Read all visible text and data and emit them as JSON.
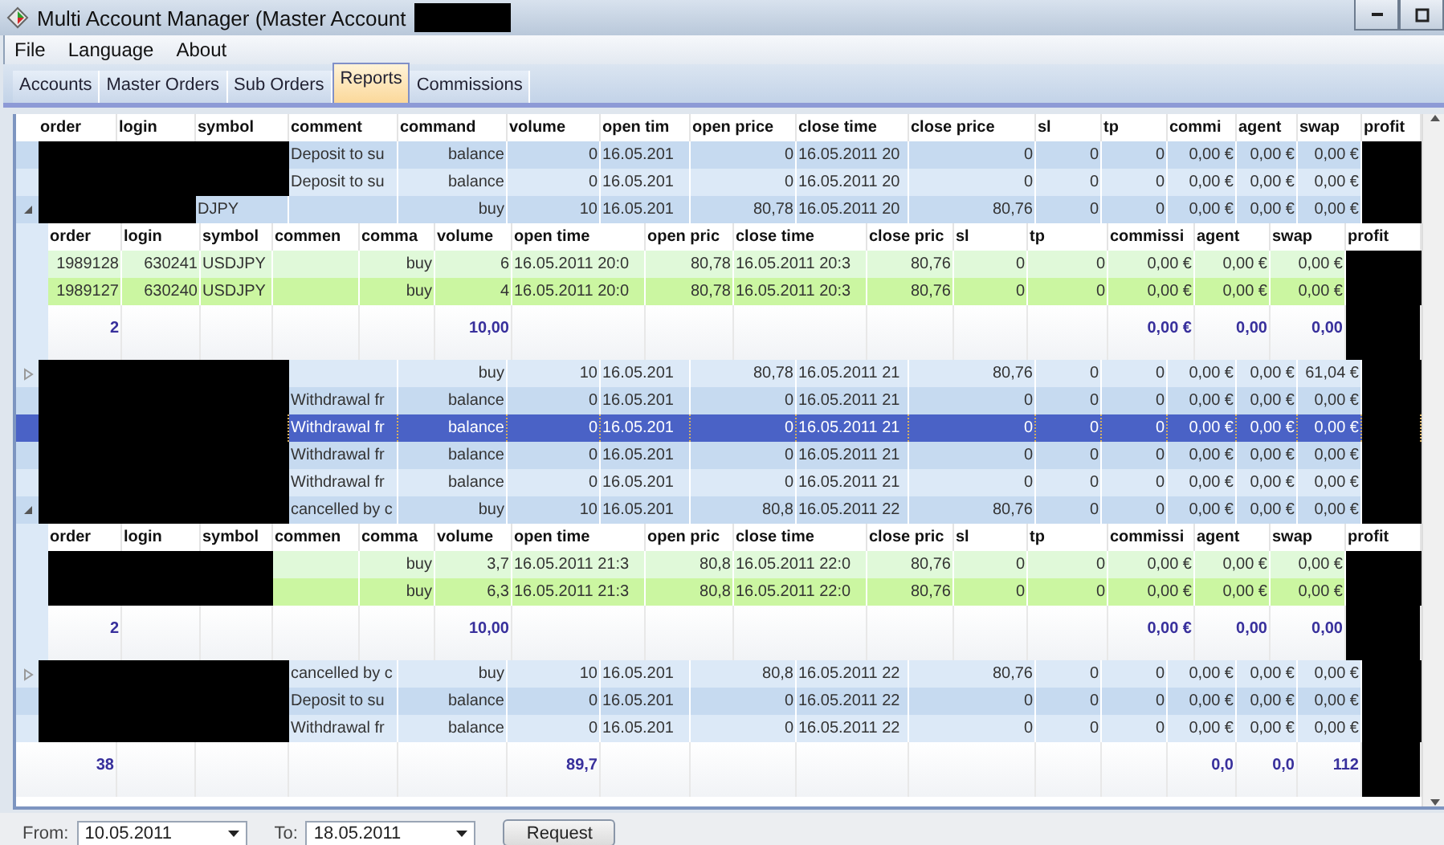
{
  "window": {
    "title": "Multi Account Manager (Master Account"
  },
  "menu": [
    {
      "label": "File"
    },
    {
      "label": "Language"
    },
    {
      "label": "About"
    }
  ],
  "tabs": [
    {
      "label": "Accounts",
      "selected": false
    },
    {
      "label": "Master Orders",
      "selected": false
    },
    {
      "label": "Sub Orders",
      "selected": false
    },
    {
      "label": "Reports",
      "selected": true
    },
    {
      "label": "Commissions",
      "selected": false
    }
  ],
  "table": {
    "columns": [
      "order",
      "login",
      "symbol",
      "comment",
      "command",
      "volume",
      "open tim",
      "open price",
      "close time",
      "close price",
      "sl",
      "tp",
      "commi",
      "agent",
      "swap",
      "profit"
    ],
    "rows": [
      {
        "kind": "record",
        "selected": false,
        "cells": [
          {
            "kind": "redacted"
          },
          {
            "kind": "redacted"
          },
          {
            "kind": "redacted"
          },
          "Deposit to su",
          "balance",
          "0",
          "16.05.201",
          "0",
          "16.05.2011 20",
          "0",
          "0",
          "0",
          "0,00 €",
          "0,00 €",
          "0,00 €",
          {
            "kind": "redacted"
          }
        ]
      },
      {
        "kind": "record",
        "selected": false,
        "cells": [
          {
            "kind": "redacted"
          },
          {
            "kind": "redacted"
          },
          {
            "kind": "redacted"
          },
          "Deposit to su",
          "balance",
          "0",
          "16.05.201",
          "0",
          "16.05.2011 20",
          "0",
          "0",
          "0",
          "0,00 €",
          "0,00 €",
          "0,00 €",
          {
            "kind": "redacted"
          }
        ]
      },
      {
        "kind": "record",
        "selected": false,
        "expanded": true,
        "cells": [
          {
            "kind": "redacted"
          },
          {
            "kind": "redacted"
          },
          "DJPY",
          {
            "kind": "blank"
          },
          "buy",
          "10",
          "16.05.201",
          "80,78",
          "16.05.2011 20",
          "80,76",
          "0",
          "0",
          "0,00 €",
          "0,00 €",
          "0,00 €",
          {
            "kind": "redacted"
          }
        ]
      },
      {
        "kind": "detail",
        "columns": [
          "order",
          "login",
          "symbol",
          "commen",
          "comma",
          "volume",
          "open time",
          "open pric",
          "close time",
          "close pric",
          "sl",
          "tp",
          "commissi",
          "agent",
          "swap",
          "profit"
        ],
        "rows": [
          {
            "cells": [
              "1989128",
              "630241",
              "USDJPY",
              {
                "kind": "blank"
              },
              "buy",
              "6",
              "16.05.2011 20:0",
              "80,78",
              "16.05.2011 20:3",
              "80,76",
              "0",
              "0",
              "0,00 €",
              "0,00 €",
              "0,00 €",
              {
                "kind": "redacted"
              }
            ]
          },
          {
            "cells": [
              "1989127",
              "630240",
              "USDJPY",
              {
                "kind": "blank"
              },
              "buy",
              "4",
              "16.05.2011 20:0",
              "80,78",
              "16.05.2011 20:3",
              "80,76",
              "0",
              "0",
              "0,00 €",
              "0,00 €",
              "0,00 €",
              {
                "kind": "redacted"
              }
            ]
          }
        ],
        "totals": [
          "2",
          {
            "kind": "blank"
          },
          {
            "kind": "blank"
          },
          {
            "kind": "blank"
          },
          {
            "kind": "blank"
          },
          "10,00",
          {
            "kind": "blank"
          },
          {
            "kind": "blank"
          },
          {
            "kind": "blank"
          },
          {
            "kind": "blank"
          },
          {
            "kind": "blank"
          },
          {
            "kind": "blank"
          },
          "0,00 €",
          "0,00",
          "0,00",
          {
            "kind": "redacted"
          }
        ]
      },
      {
        "kind": "record",
        "selected": false,
        "expanded": false,
        "cells": [
          {
            "kind": "redacted"
          },
          {
            "kind": "redacted"
          },
          {
            "kind": "redacted"
          },
          {
            "kind": "blank"
          },
          "buy",
          "10",
          "16.05.201",
          "80,78",
          "16.05.2011 21",
          "80,76",
          "0",
          "0",
          "0,00 €",
          "0,00 €",
          "61,04 €",
          {
            "kind": "redacted"
          }
        ]
      },
      {
        "kind": "record",
        "selected": false,
        "cells": [
          {
            "kind": "redacted"
          },
          {
            "kind": "redacted"
          },
          {
            "kind": "redacted"
          },
          "Withdrawal fr",
          "balance",
          "0",
          "16.05.201",
          "0",
          "16.05.2011 21",
          "0",
          "0",
          "0",
          "0,00 €",
          "0,00 €",
          "0,00 €",
          {
            "kind": "redacted"
          }
        ]
      },
      {
        "kind": "record",
        "selected": true,
        "cells": [
          {
            "kind": "redacted"
          },
          {
            "kind": "redacted"
          },
          {
            "kind": "redacted"
          },
          "Withdrawal fr",
          "balance",
          "0",
          "16.05.201",
          "0",
          "16.05.2011 21",
          "0",
          "0",
          "0",
          "0,00 €",
          "0,00 €",
          "0,00 €",
          {
            "kind": "redacted"
          }
        ]
      },
      {
        "kind": "record",
        "selected": false,
        "cells": [
          {
            "kind": "redacted"
          },
          {
            "kind": "redacted"
          },
          {
            "kind": "redacted"
          },
          "Withdrawal fr",
          "balance",
          "0",
          "16.05.201",
          "0",
          "16.05.2011 21",
          "0",
          "0",
          "0",
          "0,00 €",
          "0,00 €",
          "0,00 €",
          {
            "kind": "redacted"
          }
        ]
      },
      {
        "kind": "record",
        "selected": false,
        "cells": [
          {
            "kind": "redacted"
          },
          {
            "kind": "redacted"
          },
          {
            "kind": "redacted"
          },
          "Withdrawal fr",
          "balance",
          "0",
          "16.05.201",
          "0",
          "16.05.2011 21",
          "0",
          "0",
          "0",
          "0,00 €",
          "0,00 €",
          "0,00 €",
          {
            "kind": "redacted"
          }
        ]
      },
      {
        "kind": "record",
        "selected": false,
        "expanded": true,
        "cells": [
          {
            "kind": "redacted"
          },
          {
            "kind": "redacted"
          },
          {
            "kind": "redacted"
          },
          "cancelled by c",
          "buy",
          "10",
          "16.05.201",
          "80,8",
          "16.05.2011 22",
          "80,76",
          "0",
          "0",
          "0,00 €",
          "0,00 €",
          "0,00 €",
          {
            "kind": "redacted"
          }
        ]
      },
      {
        "kind": "detail",
        "columns": [
          "order",
          "login",
          "symbol",
          "commen",
          "comma",
          "volume",
          "open time",
          "open pric",
          "close time",
          "close pric",
          "sl",
          "tp",
          "commissi",
          "agent",
          "swap",
          "profit"
        ],
        "rows": [
          {
            "cells": [
              {
                "kind": "redacted"
              },
              {
                "kind": "redacted"
              },
              {
                "kind": "redacted"
              },
              {
                "kind": "blank"
              },
              "buy",
              "3,7",
              "16.05.2011 21:3",
              "80,8",
              "16.05.2011 22:0",
              "80,76",
              "0",
              "0",
              "0,00 €",
              "0,00 €",
              "0,00 €",
              {
                "kind": "redacted"
              }
            ]
          },
          {
            "cells": [
              {
                "kind": "redacted"
              },
              {
                "kind": "redacted"
              },
              {
                "kind": "redacted"
              },
              {
                "kind": "blank"
              },
              "buy",
              "6,3",
              "16.05.2011 21:3",
              "80,8",
              "16.05.2011 22:0",
              "80,76",
              "0",
              "0",
              "0,00 €",
              "0,00 €",
              "0,00 €",
              {
                "kind": "redacted"
              }
            ]
          }
        ],
        "totals": [
          "2",
          {
            "kind": "blank"
          },
          {
            "kind": "blank"
          },
          {
            "kind": "blank"
          },
          {
            "kind": "blank"
          },
          "10,00",
          {
            "kind": "blank"
          },
          {
            "kind": "blank"
          },
          {
            "kind": "blank"
          },
          {
            "kind": "blank"
          },
          {
            "kind": "blank"
          },
          {
            "kind": "blank"
          },
          "0,00 €",
          "0,00",
          "0,00",
          {
            "kind": "redacted"
          }
        ]
      },
      {
        "kind": "record",
        "selected": false,
        "expanded": false,
        "cells": [
          {
            "kind": "redacted"
          },
          {
            "kind": "redacted"
          },
          {
            "kind": "redacted"
          },
          "cancelled by c",
          "buy",
          "10",
          "16.05.201",
          "80,8",
          "16.05.2011 22",
          "80,76",
          "0",
          "0",
          "0,00 €",
          "0,00 €",
          "0,00 €",
          {
            "kind": "redacted"
          }
        ]
      },
      {
        "kind": "record",
        "selected": false,
        "cells": [
          {
            "kind": "redacted"
          },
          {
            "kind": "redacted"
          },
          {
            "kind": "redacted"
          },
          "Deposit to su",
          "balance",
          "0",
          "16.05.201",
          "0",
          "16.05.2011 22",
          "0",
          "0",
          "0",
          "0,00 €",
          "0,00 €",
          "0,00 €",
          {
            "kind": "redacted"
          }
        ]
      },
      {
        "kind": "record",
        "selected": false,
        "cells": [
          {
            "kind": "redacted"
          },
          {
            "kind": "redacted"
          },
          {
            "kind": "redacted"
          },
          "Withdrawal fr",
          "balance",
          "0",
          "16.05.201",
          "0",
          "16.05.2011 22",
          "0",
          "0",
          "0",
          "0,00 €",
          "0,00 €",
          "0,00 €",
          {
            "kind": "redacted"
          }
        ]
      }
    ],
    "totals": [
      "38",
      {
        "kind": "blank"
      },
      {
        "kind": "blank"
      },
      {
        "kind": "blank"
      },
      {
        "kind": "blank"
      },
      "89,7",
      {
        "kind": "blank"
      },
      {
        "kind": "blank"
      },
      {
        "kind": "blank"
      },
      {
        "kind": "blank"
      },
      {
        "kind": "blank"
      },
      {
        "kind": "blank"
      },
      "0,0",
      "0,0",
      "112",
      {
        "kind": "redacted"
      }
    ]
  },
  "filter": {
    "from_label": "From:",
    "from": "10.05.2011",
    "to_label": "To:",
    "to": "18.05.2011",
    "button": "Request"
  }
}
